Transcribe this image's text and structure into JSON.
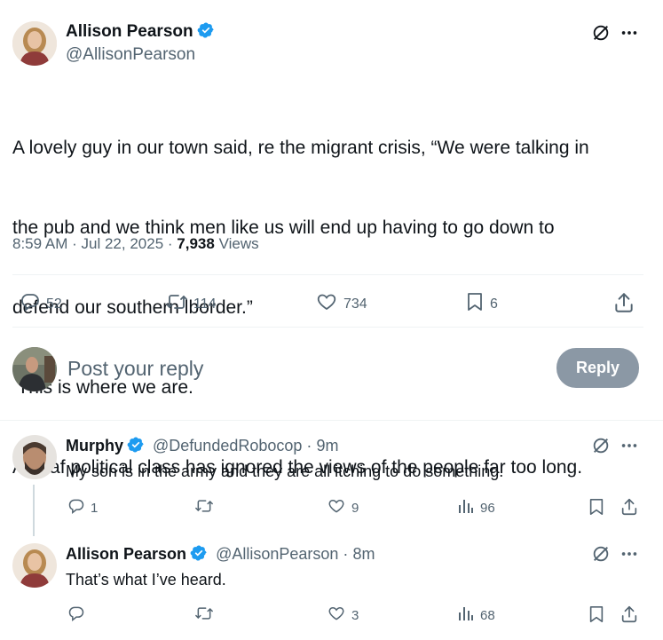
{
  "main_tweet": {
    "author_name": "Allison Pearson",
    "author_handle": "@AllisonPearson",
    "text_lines": [
      "A lovely guy in our town said, re the migrant crisis, “We were talking in",
      "the pub and we think men like us will end up having to go down to",
      "defend our southern lborder.”",
      " This is where we are.",
      "A deaf political class has ignored the views of the people far too long."
    ],
    "time": "8:59 AM",
    "date": "Jul 22, 2025",
    "views_count": "7,938",
    "views_label": "Views",
    "replies": "52",
    "reposts": "114",
    "likes": "734",
    "bookmarks": "6"
  },
  "composer": {
    "placeholder": "Post your reply",
    "button_label": "Reply"
  },
  "replies": [
    {
      "author_name": "Murphy",
      "author_handle": "@DefundedRobocop",
      "age": "9m",
      "text": "My son is in the army and they are all itching to do something.",
      "replies": "1",
      "reposts": "",
      "likes": "9",
      "views": "96"
    },
    {
      "author_name": "Allison Pearson",
      "author_handle": "@AllisonPearson",
      "age": "8m",
      "text": "That’s what I’ve heard.",
      "replies": "",
      "reposts": "",
      "likes": "3",
      "views": "68"
    }
  ],
  "separator": "·",
  "colors": {
    "verified": "#1d9bf0",
    "muted": "#536471",
    "reply_button": "#8b98a5",
    "divider": "#eff3f4"
  }
}
